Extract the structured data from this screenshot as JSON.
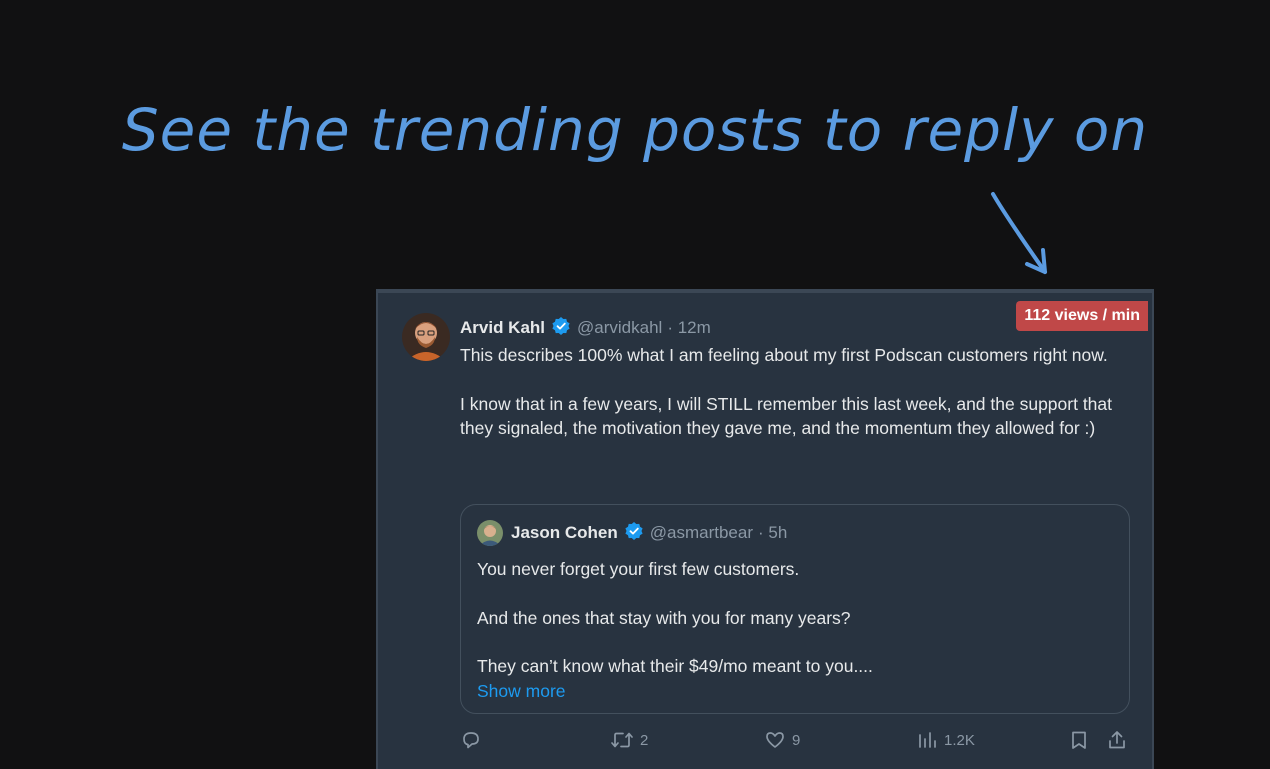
{
  "headline": "See the trending posts to reply on",
  "badge": {
    "text": "112 views / min",
    "color": "#c04848"
  },
  "post": {
    "author_name": "Arvid Kahl",
    "handle": "@arvidkahl",
    "time": "· 12m",
    "paragraphs": [
      "This describes 100% what I am feeling about my first Podscan customers right now.",
      "I know that in a few years, I will STILL remember this last week, and the support that they signaled, the motivation they gave me, and the momentum they allowed for :)"
    ]
  },
  "quote": {
    "author_name": "Jason Cohen",
    "handle": "@asmartbear",
    "time": "· 5h",
    "paragraphs": [
      "You never forget your first few customers.",
      "And the ones that stay with you for many years?",
      "They can’t know what their $49/mo meant to you...."
    ],
    "show_more": "Show more"
  },
  "actions": {
    "reply_icon": "reply-icon",
    "retweet_count": "2",
    "like_count": "9",
    "views_count": "1.2K",
    "bookmark_icon": "bookmark-icon",
    "share_icon": "share-icon"
  },
  "colors": {
    "accent": "#1d9bf0",
    "headline": "#5b9be0",
    "card_bg": "#283340"
  }
}
